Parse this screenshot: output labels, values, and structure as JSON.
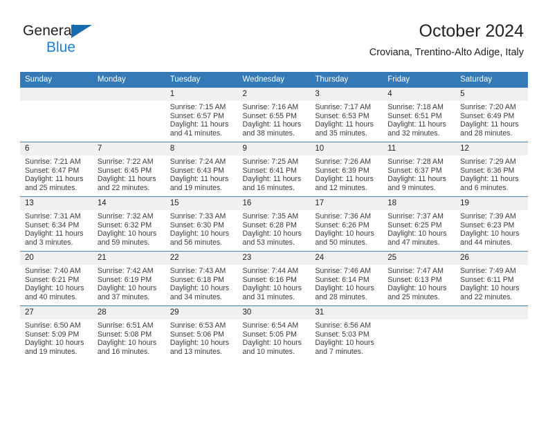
{
  "brand": {
    "word1": "General",
    "word2": "Blue",
    "triangle_color": "#1769b0",
    "blue_color": "#1b80d4"
  },
  "header": {
    "title": "October 2024",
    "subtitle": "Croviana, Trentino-Alto Adige, Italy"
  },
  "theme": {
    "header_blue": "#337ab7",
    "grid_line": "#4a7ebb",
    "daynum_bg": "#f0f0f0"
  },
  "weekday_headers": [
    "Sunday",
    "Monday",
    "Tuesday",
    "Wednesday",
    "Thursday",
    "Friday",
    "Saturday"
  ],
  "weeks": [
    [
      {
        "day": "",
        "sunrise": "",
        "sunset": "",
        "daylight_line1": "",
        "daylight_line2": "",
        "empty": true
      },
      {
        "day": "",
        "sunrise": "",
        "sunset": "",
        "daylight_line1": "",
        "daylight_line2": "",
        "empty": true
      },
      {
        "day": "1",
        "sunrise": "Sunrise: 7:15 AM",
        "sunset": "Sunset: 6:57 PM",
        "daylight_line1": "Daylight: 11 hours",
        "daylight_line2": "and 41 minutes."
      },
      {
        "day": "2",
        "sunrise": "Sunrise: 7:16 AM",
        "sunset": "Sunset: 6:55 PM",
        "daylight_line1": "Daylight: 11 hours",
        "daylight_line2": "and 38 minutes."
      },
      {
        "day": "3",
        "sunrise": "Sunrise: 7:17 AM",
        "sunset": "Sunset: 6:53 PM",
        "daylight_line1": "Daylight: 11 hours",
        "daylight_line2": "and 35 minutes."
      },
      {
        "day": "4",
        "sunrise": "Sunrise: 7:18 AM",
        "sunset": "Sunset: 6:51 PM",
        "daylight_line1": "Daylight: 11 hours",
        "daylight_line2": "and 32 minutes."
      },
      {
        "day": "5",
        "sunrise": "Sunrise: 7:20 AM",
        "sunset": "Sunset: 6:49 PM",
        "daylight_line1": "Daylight: 11 hours",
        "daylight_line2": "and 28 minutes."
      }
    ],
    [
      {
        "day": "6",
        "sunrise": "Sunrise: 7:21 AM",
        "sunset": "Sunset: 6:47 PM",
        "daylight_line1": "Daylight: 11 hours",
        "daylight_line2": "and 25 minutes."
      },
      {
        "day": "7",
        "sunrise": "Sunrise: 7:22 AM",
        "sunset": "Sunset: 6:45 PM",
        "daylight_line1": "Daylight: 11 hours",
        "daylight_line2": "and 22 minutes."
      },
      {
        "day": "8",
        "sunrise": "Sunrise: 7:24 AM",
        "sunset": "Sunset: 6:43 PM",
        "daylight_line1": "Daylight: 11 hours",
        "daylight_line2": "and 19 minutes."
      },
      {
        "day": "9",
        "sunrise": "Sunrise: 7:25 AM",
        "sunset": "Sunset: 6:41 PM",
        "daylight_line1": "Daylight: 11 hours",
        "daylight_line2": "and 16 minutes."
      },
      {
        "day": "10",
        "sunrise": "Sunrise: 7:26 AM",
        "sunset": "Sunset: 6:39 PM",
        "daylight_line1": "Daylight: 11 hours",
        "daylight_line2": "and 12 minutes."
      },
      {
        "day": "11",
        "sunrise": "Sunrise: 7:28 AM",
        "sunset": "Sunset: 6:37 PM",
        "daylight_line1": "Daylight: 11 hours",
        "daylight_line2": "and 9 minutes."
      },
      {
        "day": "12",
        "sunrise": "Sunrise: 7:29 AM",
        "sunset": "Sunset: 6:36 PM",
        "daylight_line1": "Daylight: 11 hours",
        "daylight_line2": "and 6 minutes."
      }
    ],
    [
      {
        "day": "13",
        "sunrise": "Sunrise: 7:31 AM",
        "sunset": "Sunset: 6:34 PM",
        "daylight_line1": "Daylight: 11 hours",
        "daylight_line2": "and 3 minutes."
      },
      {
        "day": "14",
        "sunrise": "Sunrise: 7:32 AM",
        "sunset": "Sunset: 6:32 PM",
        "daylight_line1": "Daylight: 10 hours",
        "daylight_line2": "and 59 minutes."
      },
      {
        "day": "15",
        "sunrise": "Sunrise: 7:33 AM",
        "sunset": "Sunset: 6:30 PM",
        "daylight_line1": "Daylight: 10 hours",
        "daylight_line2": "and 56 minutes."
      },
      {
        "day": "16",
        "sunrise": "Sunrise: 7:35 AM",
        "sunset": "Sunset: 6:28 PM",
        "daylight_line1": "Daylight: 10 hours",
        "daylight_line2": "and 53 minutes."
      },
      {
        "day": "17",
        "sunrise": "Sunrise: 7:36 AM",
        "sunset": "Sunset: 6:26 PM",
        "daylight_line1": "Daylight: 10 hours",
        "daylight_line2": "and 50 minutes."
      },
      {
        "day": "18",
        "sunrise": "Sunrise: 7:37 AM",
        "sunset": "Sunset: 6:25 PM",
        "daylight_line1": "Daylight: 10 hours",
        "daylight_line2": "and 47 minutes."
      },
      {
        "day": "19",
        "sunrise": "Sunrise: 7:39 AM",
        "sunset": "Sunset: 6:23 PM",
        "daylight_line1": "Daylight: 10 hours",
        "daylight_line2": "and 44 minutes."
      }
    ],
    [
      {
        "day": "20",
        "sunrise": "Sunrise: 7:40 AM",
        "sunset": "Sunset: 6:21 PM",
        "daylight_line1": "Daylight: 10 hours",
        "daylight_line2": "and 40 minutes."
      },
      {
        "day": "21",
        "sunrise": "Sunrise: 7:42 AM",
        "sunset": "Sunset: 6:19 PM",
        "daylight_line1": "Daylight: 10 hours",
        "daylight_line2": "and 37 minutes."
      },
      {
        "day": "22",
        "sunrise": "Sunrise: 7:43 AM",
        "sunset": "Sunset: 6:18 PM",
        "daylight_line1": "Daylight: 10 hours",
        "daylight_line2": "and 34 minutes."
      },
      {
        "day": "23",
        "sunrise": "Sunrise: 7:44 AM",
        "sunset": "Sunset: 6:16 PM",
        "daylight_line1": "Daylight: 10 hours",
        "daylight_line2": "and 31 minutes."
      },
      {
        "day": "24",
        "sunrise": "Sunrise: 7:46 AM",
        "sunset": "Sunset: 6:14 PM",
        "daylight_line1": "Daylight: 10 hours",
        "daylight_line2": "and 28 minutes."
      },
      {
        "day": "25",
        "sunrise": "Sunrise: 7:47 AM",
        "sunset": "Sunset: 6:13 PM",
        "daylight_line1": "Daylight: 10 hours",
        "daylight_line2": "and 25 minutes."
      },
      {
        "day": "26",
        "sunrise": "Sunrise: 7:49 AM",
        "sunset": "Sunset: 6:11 PM",
        "daylight_line1": "Daylight: 10 hours",
        "daylight_line2": "and 22 minutes."
      }
    ],
    [
      {
        "day": "27",
        "sunrise": "Sunrise: 6:50 AM",
        "sunset": "Sunset: 5:09 PM",
        "daylight_line1": "Daylight: 10 hours",
        "daylight_line2": "and 19 minutes."
      },
      {
        "day": "28",
        "sunrise": "Sunrise: 6:51 AM",
        "sunset": "Sunset: 5:08 PM",
        "daylight_line1": "Daylight: 10 hours",
        "daylight_line2": "and 16 minutes."
      },
      {
        "day": "29",
        "sunrise": "Sunrise: 6:53 AM",
        "sunset": "Sunset: 5:06 PM",
        "daylight_line1": "Daylight: 10 hours",
        "daylight_line2": "and 13 minutes."
      },
      {
        "day": "30",
        "sunrise": "Sunrise: 6:54 AM",
        "sunset": "Sunset: 5:05 PM",
        "daylight_line1": "Daylight: 10 hours",
        "daylight_line2": "and 10 minutes."
      },
      {
        "day": "31",
        "sunrise": "Sunrise: 6:56 AM",
        "sunset": "Sunset: 5:03 PM",
        "daylight_line1": "Daylight: 10 hours",
        "daylight_line2": "and 7 minutes."
      },
      {
        "day": "",
        "sunrise": "",
        "sunset": "",
        "daylight_line1": "",
        "daylight_line2": "",
        "empty": true
      },
      {
        "day": "",
        "sunrise": "",
        "sunset": "",
        "daylight_line1": "",
        "daylight_line2": "",
        "empty": true
      }
    ]
  ]
}
